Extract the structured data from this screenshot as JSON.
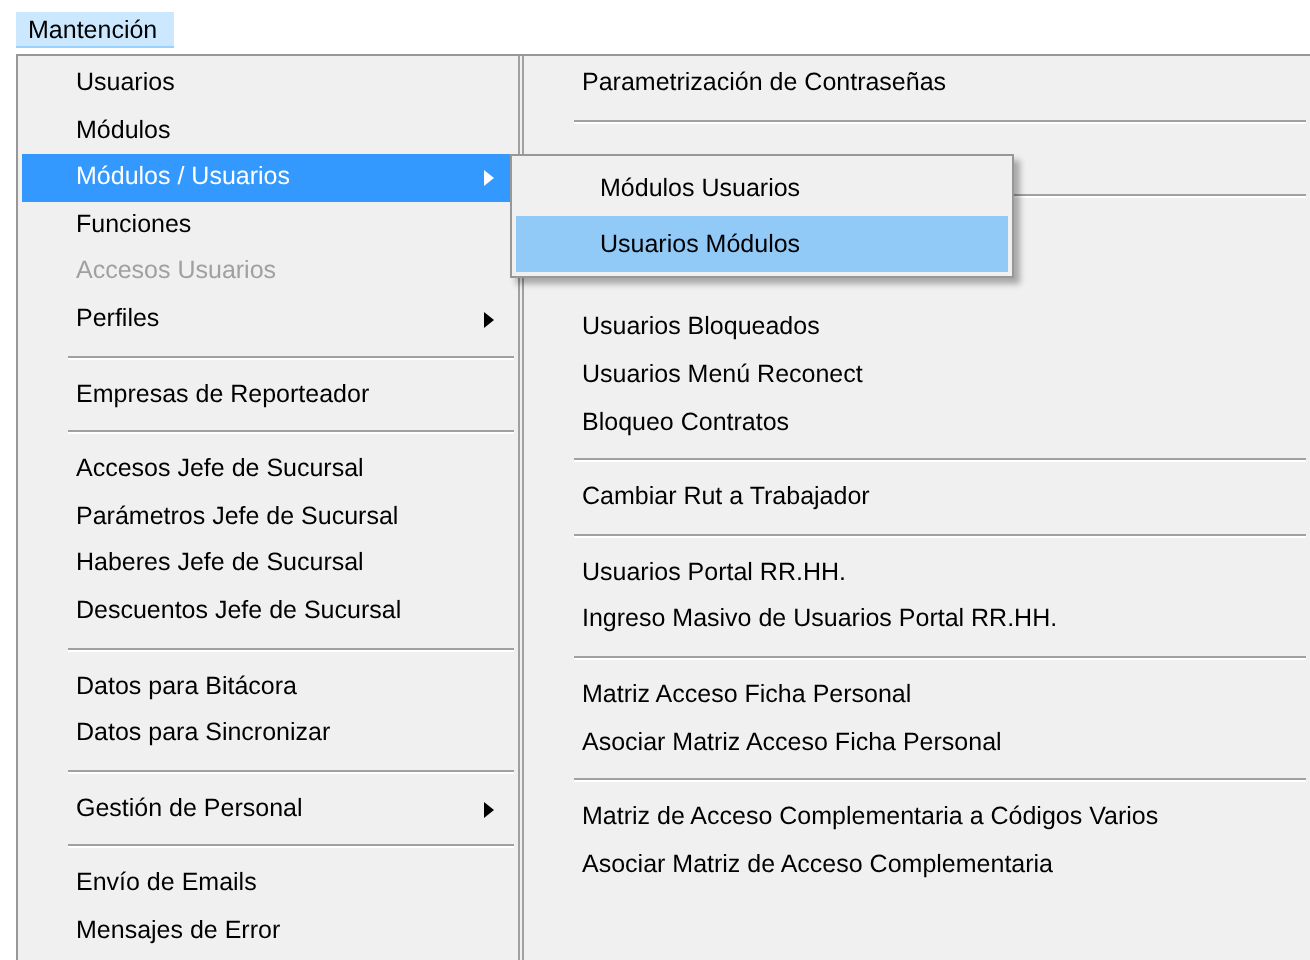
{
  "menu_bar": [
    {
      "label": "Mantención",
      "selected": true
    }
  ],
  "menu": {
    "columns": [
      {
        "items": [
          {
            "kind": "item",
            "label": "Usuarios",
            "disabled": false,
            "submenu": false,
            "selected": false
          },
          {
            "kind": "item",
            "label": "Módulos",
            "disabled": false,
            "submenu": false,
            "selected": false
          },
          {
            "kind": "item",
            "label": "Módulos / Usuarios",
            "disabled": false,
            "submenu": true,
            "selected": true
          },
          {
            "kind": "item",
            "label": "Funciones",
            "disabled": false,
            "submenu": false,
            "selected": false
          },
          {
            "kind": "item",
            "label": "Accesos Usuarios",
            "disabled": true,
            "submenu": false,
            "selected": false
          },
          {
            "kind": "item",
            "label": "Perfiles",
            "disabled": false,
            "submenu": true,
            "selected": false
          },
          {
            "kind": "separator"
          },
          {
            "kind": "item",
            "label": "Empresas de Reporteador",
            "disabled": false,
            "submenu": false,
            "selected": false
          },
          {
            "kind": "separator"
          },
          {
            "kind": "item",
            "label": "Accesos Jefe de Sucursal",
            "disabled": false,
            "submenu": false,
            "selected": false
          },
          {
            "kind": "item",
            "label": "Parámetros Jefe de Sucursal",
            "disabled": false,
            "submenu": false,
            "selected": false
          },
          {
            "kind": "item",
            "label": "Haberes Jefe de Sucursal",
            "disabled": false,
            "submenu": false,
            "selected": false
          },
          {
            "kind": "item",
            "label": "Descuentos Jefe de Sucursal",
            "disabled": false,
            "submenu": false,
            "selected": false
          },
          {
            "kind": "separator"
          },
          {
            "kind": "item",
            "label": "Datos para Bitácora",
            "disabled": false,
            "submenu": false,
            "selected": false
          },
          {
            "kind": "item",
            "label": "Datos para Sincronizar",
            "disabled": false,
            "submenu": false,
            "selected": false
          },
          {
            "kind": "separator"
          },
          {
            "kind": "item",
            "label": "Gestión de Personal",
            "disabled": false,
            "submenu": true,
            "selected": false
          },
          {
            "kind": "separator"
          },
          {
            "kind": "item",
            "label": "Envío de Emails",
            "disabled": false,
            "submenu": false,
            "selected": false
          },
          {
            "kind": "item",
            "label": "Mensajes de Error",
            "disabled": false,
            "submenu": false,
            "selected": false
          }
        ]
      },
      {
        "items": [
          {
            "kind": "item",
            "label": "Parametrización de Contraseñas",
            "disabled": false,
            "submenu": false,
            "selected": false
          },
          {
            "kind": "separator"
          },
          {
            "kind": "covered"
          },
          {
            "kind": "separator"
          },
          {
            "kind": "covered"
          },
          {
            "kind": "covered"
          },
          {
            "kind": "item",
            "label": "Usuarios Bloqueados",
            "disabled": false,
            "submenu": false,
            "selected": false
          },
          {
            "kind": "item",
            "label": "Usuarios Menú Reconect",
            "disabled": false,
            "submenu": false,
            "selected": false
          },
          {
            "kind": "item",
            "label": "Bloqueo Contratos",
            "disabled": false,
            "submenu": false,
            "selected": false
          },
          {
            "kind": "separator"
          },
          {
            "kind": "item",
            "label": "Cambiar Rut a Trabajador",
            "disabled": false,
            "submenu": false,
            "selected": false
          },
          {
            "kind": "separator"
          },
          {
            "kind": "item",
            "label": "Usuarios Portal RR.HH.",
            "disabled": false,
            "submenu": false,
            "selected": false
          },
          {
            "kind": "item",
            "label": "Ingreso Masivo de Usuarios Portal RR.HH.",
            "disabled": false,
            "submenu": false,
            "selected": false
          },
          {
            "kind": "separator"
          },
          {
            "kind": "item",
            "label": "Matriz Acceso Ficha Personal",
            "disabled": false,
            "submenu": false,
            "selected": false
          },
          {
            "kind": "item",
            "label": "Asociar Matriz Acceso Ficha Personal",
            "disabled": false,
            "submenu": false,
            "selected": false
          },
          {
            "kind": "separator"
          },
          {
            "kind": "item",
            "label": "Matriz de Acceso Complementaria a Códigos Varios",
            "disabled": false,
            "submenu": false,
            "selected": false
          },
          {
            "kind": "item",
            "label": "Asociar Matriz de Acceso Complementaria",
            "disabled": false,
            "submenu": false,
            "selected": false
          }
        ]
      }
    ]
  },
  "submenu": {
    "items": [
      {
        "label": "Módulos Usuarios",
        "selected": false
      },
      {
        "label": "Usuarios Módulos",
        "selected": true
      }
    ]
  }
}
